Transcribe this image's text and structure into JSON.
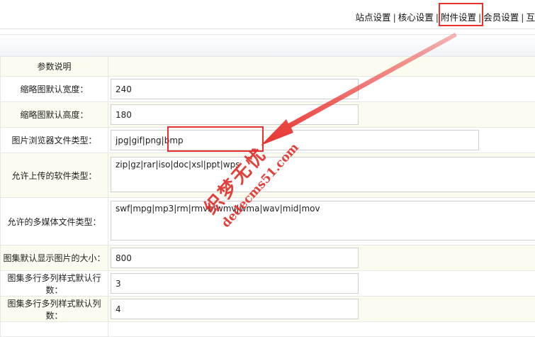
{
  "nav": {
    "items": [
      "站点设置",
      "核心设置",
      "附件设置",
      "会员设置",
      "互"
    ],
    "separator": "|"
  },
  "table": {
    "header_label": "参数说明",
    "rows": [
      {
        "label": "缩略图默认宽度：",
        "value": "240",
        "kind": "input"
      },
      {
        "label": "缩略图默认高度：",
        "value": "180",
        "kind": "input"
      },
      {
        "label": "图片浏览器文件类型：",
        "value": "jpg|gif|png|bmp",
        "kind": "input"
      },
      {
        "label": "允许上传的软件类型：",
        "value": "zip|gz|rar|iso|doc|xsl|ppt|wps",
        "kind": "textarea"
      },
      {
        "label": "允许的多媒体文件类型：",
        "value": "swf|mpg|mp3|rm|rmvb|wmv|wma|wav|mid|mov",
        "kind": "textarea"
      },
      {
        "label": "图集默认显示图片的大小：",
        "value": "800",
        "kind": "input"
      },
      {
        "label": "图集多行多列样式默认行数：",
        "value": "3",
        "kind": "input"
      },
      {
        "label": "图集多行多列样式默认列数：",
        "value": "4",
        "kind": "input"
      }
    ]
  },
  "watermark": {
    "text": "织梦无忧",
    "url": "dedecms51.com"
  },
  "colors": {
    "highlight": "#e8322f",
    "row_alt": "#fbfbef"
  }
}
